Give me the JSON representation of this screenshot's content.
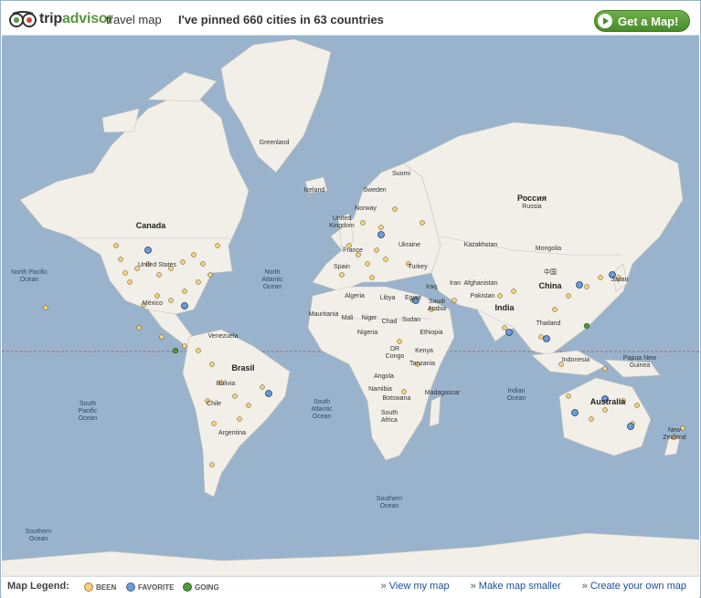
{
  "header": {
    "logo_trip": "trip",
    "logo_advisor": "advisor",
    "subtitle": "travel map",
    "stats": "I've pinned 660 cities in 63 countries",
    "get_map_label": "Get a Map!"
  },
  "map_labels": [
    {
      "text": "Greenland"
    },
    {
      "text": "Iceland"
    },
    {
      "text": "Canada"
    },
    {
      "text": "United States"
    },
    {
      "text": "México"
    },
    {
      "text": "North Pacific Ocean"
    },
    {
      "text": "North Atlantic Ocean"
    },
    {
      "text": "Venezuela"
    },
    {
      "text": "Brasil"
    },
    {
      "text": "Bolivia"
    },
    {
      "text": "Chile"
    },
    {
      "text": "Argentina"
    },
    {
      "text": "South Pacific Ocean"
    },
    {
      "text": "South Atlantic Ocean"
    },
    {
      "text": "Southern Ocean"
    },
    {
      "text": "Southern Ocean"
    },
    {
      "text": "Sweden"
    },
    {
      "text": "Suomi"
    },
    {
      "text": "Norway"
    },
    {
      "text": "United Kingdom"
    },
    {
      "text": "France"
    },
    {
      "text": "Spain"
    },
    {
      "text": "Ukraine"
    },
    {
      "text": "Россия"
    },
    {
      "text": "Russia"
    },
    {
      "text": "Kazakhstan"
    },
    {
      "text": "Mongolia"
    },
    {
      "text": "中国"
    },
    {
      "text": "China"
    },
    {
      "text": "Japan"
    },
    {
      "text": "Turkey"
    },
    {
      "text": "Iran"
    },
    {
      "text": "Afghanistan"
    },
    {
      "text": "Iraq"
    },
    {
      "text": "Saudi Arabia"
    },
    {
      "text": "Pakistan"
    },
    {
      "text": "India"
    },
    {
      "text": "Thailand"
    },
    {
      "text": "Algeria"
    },
    {
      "text": "Libya"
    },
    {
      "text": "Egypt"
    },
    {
      "text": "Mauritania"
    },
    {
      "text": "Mali"
    },
    {
      "text": "Niger"
    },
    {
      "text": "Chad"
    },
    {
      "text": "Sudan"
    },
    {
      "text": "Ethiopia"
    },
    {
      "text": "Nigeria"
    },
    {
      "text": "DR Congo"
    },
    {
      "text": "Kenya"
    },
    {
      "text": "Tanzania"
    },
    {
      "text": "Angola"
    },
    {
      "text": "Namibia"
    },
    {
      "text": "Botswana"
    },
    {
      "text": "South Africa"
    },
    {
      "text": "Madagascar"
    },
    {
      "text": "Indian Ocean"
    },
    {
      "text": "Indonesia"
    },
    {
      "text": "Papua New Guinea"
    },
    {
      "text": "Australia"
    },
    {
      "text": "New Zealand"
    }
  ],
  "footer": {
    "legend_title": "Map Legend:",
    "legend_been": "BEEN",
    "legend_favorite": "FAVORITE",
    "legend_going": "GOING",
    "link_view": "View my map",
    "link_smaller": "Make map smaller",
    "link_create": "Create your own map"
  },
  "colors": {
    "ocean": "#99b3cc",
    "land": "#f2efe9",
    "pin_been": "#f3d27a",
    "pin_favorite": "#6b9bd6",
    "pin_going": "#4f9a3a",
    "brand_green": "#589442"
  }
}
